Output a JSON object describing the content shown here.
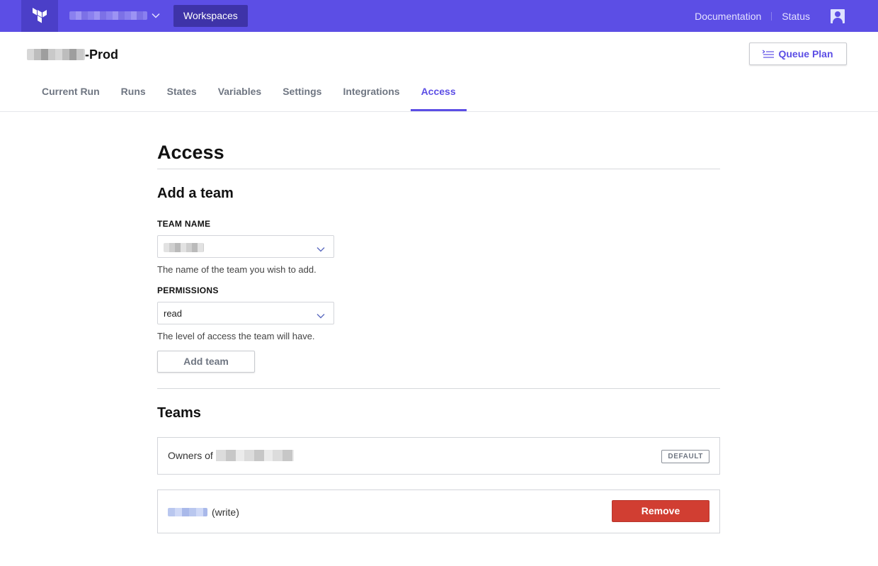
{
  "topbar": {
    "workspaces_label": "Workspaces",
    "documentation_label": "Documentation",
    "status_label": "Status",
    "brand_color": "#5c4ee5"
  },
  "workspace": {
    "name_suffix": "-Prod",
    "queue_plan_label": "Queue Plan"
  },
  "tabs": [
    {
      "label": "Current Run"
    },
    {
      "label": "Runs"
    },
    {
      "label": "States"
    },
    {
      "label": "Variables"
    },
    {
      "label": "Settings"
    },
    {
      "label": "Integrations"
    },
    {
      "label": "Access",
      "active": true
    }
  ],
  "page": {
    "title": "Access",
    "add_team": {
      "heading": "Add a team",
      "team_name_label": "TEAM NAME",
      "team_name_help": "The name of the team you wish to add.",
      "permissions_label": "PERMISSIONS",
      "permissions_value": "read",
      "permissions_help": "The level of access the team will have.",
      "add_button": "Add team"
    },
    "teams": {
      "heading": "Teams",
      "rows": [
        {
          "prefix": "Owners of",
          "badge": "DEFAULT"
        },
        {
          "permission": "(write)",
          "action": "Remove"
        }
      ]
    }
  },
  "colors": {
    "accent": "#5c4ee5",
    "danger": "#d13e32"
  }
}
